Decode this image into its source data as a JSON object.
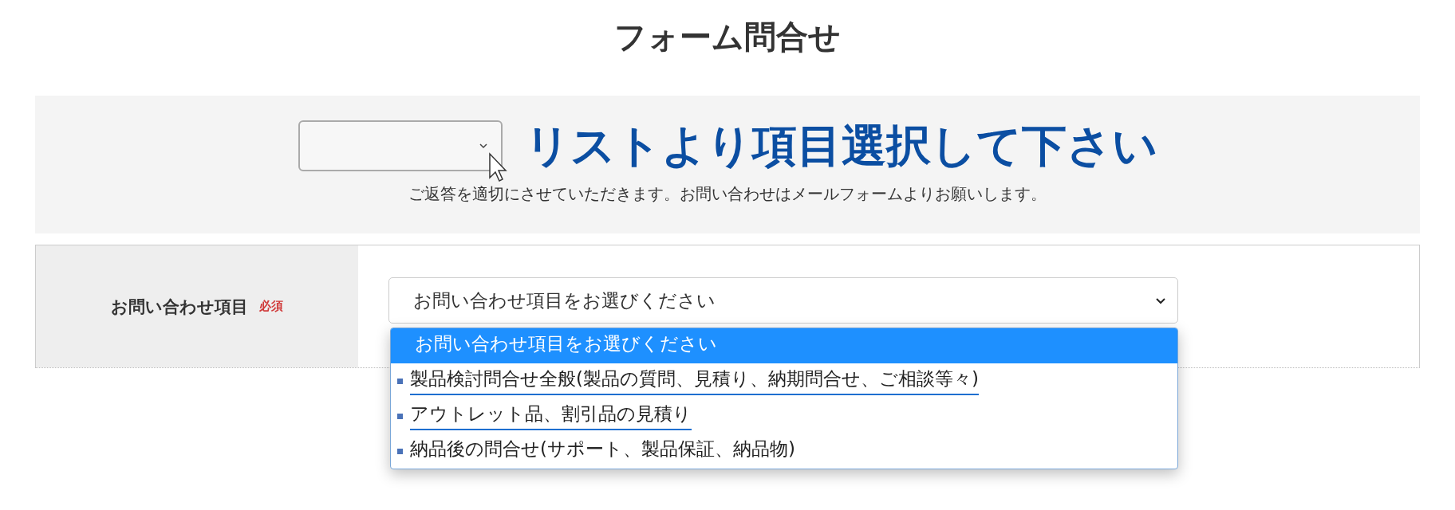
{
  "page_title": "フォーム問合せ",
  "banner": {
    "headline": "リストより項目選択して下さい",
    "note": "ご返答を適切にさせていただきます。お問い合わせはメールフォームよりお願いします。"
  },
  "form": {
    "label": "お問い合わせ項目",
    "required_badge": "必須",
    "select": {
      "value": "お問い合わせ項目をお選びください",
      "expanded": true
    },
    "options": [
      {
        "kind": "placeholder",
        "label": "お問い合わせ項目をお選びください",
        "selected": true,
        "underlined": false
      },
      {
        "kind": "bullet",
        "label": "製品検討問合せ全般(製品の質問、見積り、納期問合せ、ご相談等々)",
        "selected": false,
        "underlined": true
      },
      {
        "kind": "bullet",
        "label": "アウトレット品、割引品の見積り",
        "selected": false,
        "underlined": true
      },
      {
        "kind": "bullet",
        "label": "納品後の問合せ(サポート、製品保証、納品物)",
        "selected": false,
        "underlined": false
      }
    ]
  }
}
